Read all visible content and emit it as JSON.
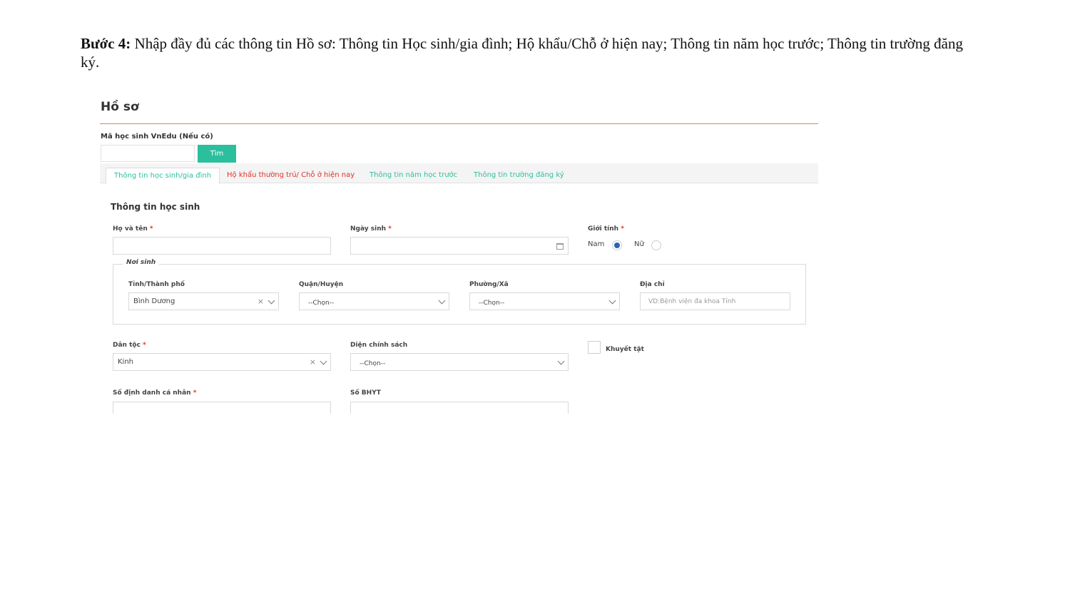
{
  "instruction": {
    "step": "Bước 4:",
    "text": "Nhập đầy đủ các thông tin Hồ sơ: Thông tin Học sinh/gia đình; Hộ khẩu/Chỗ ở hiện nay; Thông tin năm học trước; Thông tin trường đăng ký."
  },
  "page": {
    "title": "Hồ sơ"
  },
  "vnedu": {
    "label": "Mã học sinh VnEdu (Nếu có)",
    "value": "",
    "search_label": "Tìm"
  },
  "tabs": [
    {
      "label": "Thông tin học sinh/gia đình"
    },
    {
      "label": "Hộ khẩu thường trú/ Chỗ ở hiện nay"
    },
    {
      "label": "Thông tin năm học trước"
    },
    {
      "label": "Thông tin trường đăng ký"
    }
  ],
  "colors": {
    "accent": "#2bbf9e",
    "required": "#e0312b",
    "divider": "#d8806f",
    "radio_selected": "#2b63b8"
  },
  "student": {
    "section_title": "Thông tin học sinh",
    "required_mark": "*",
    "full_name": {
      "label": "Họ và tên",
      "value": ""
    },
    "dob": {
      "label": "Ngày sinh",
      "value": ""
    },
    "gender": {
      "label": "Giới tính",
      "options": [
        "Nam",
        "Nữ"
      ],
      "selected": "Nam"
    },
    "birthplace": {
      "legend": "Nơi sinh",
      "province": {
        "label": "Tỉnh/Thành phố",
        "value": "Bình Dương",
        "clear": "×"
      },
      "district": {
        "label": "Quận/Huyện",
        "value": "--Chọn--"
      },
      "ward": {
        "label": "Phường/Xã",
        "value": "--Chọn--"
      },
      "address": {
        "label": "Địa chỉ",
        "placeholder": "VD:Bệnh viện đa khoa Tỉnh"
      }
    },
    "ethnicity": {
      "label": "Dân tộc",
      "value": "Kinh",
      "clear": "×"
    },
    "policy": {
      "label": "Diện chính sách",
      "value": "--Chọn--"
    },
    "disability": {
      "label": "Khuyết tật",
      "checked": false
    },
    "personal_id": {
      "label": "Số định danh cá nhân",
      "value": ""
    },
    "health_insurance": {
      "label": "Số BHYT",
      "value": ""
    }
  }
}
